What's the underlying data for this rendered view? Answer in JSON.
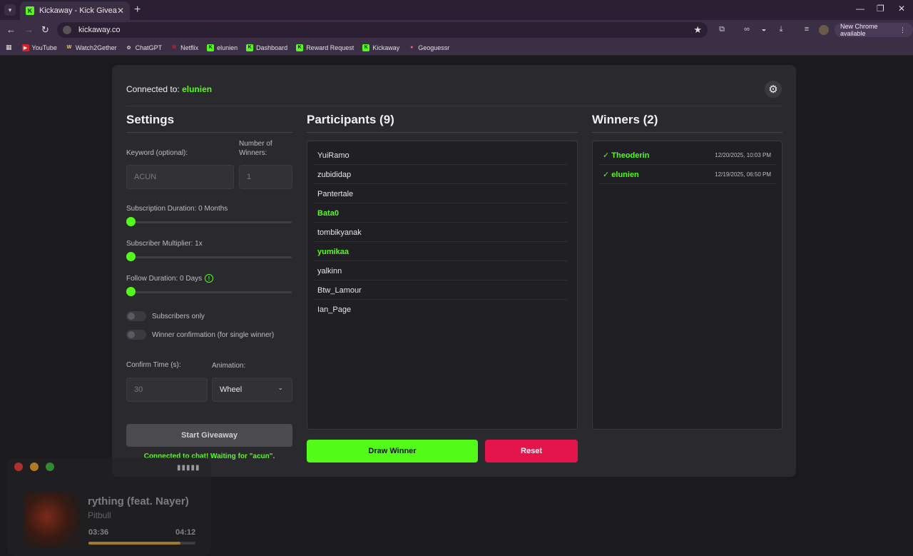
{
  "browser": {
    "tab_title": "Kickaway - Kick Giveaway Tool",
    "url": "kickaway.co",
    "new_chrome_label": "New Chrome available",
    "bookmarks": [
      "YouTube",
      "Watch2Gether",
      "ChatGPT",
      "Netflix",
      "elunien",
      "Dashboard",
      "Reward Request",
      "Kickaway",
      "Geoguessr"
    ]
  },
  "header": {
    "connected_prefix": "Connected to:",
    "connected_user": "elunien"
  },
  "settings": {
    "title": "Settings",
    "keyword_label": "Keyword (optional):",
    "keyword_placeholder": "ACUN",
    "winners_label": "Number of Winners:",
    "winners_placeholder": "1",
    "subscription_label": "Subscription Duration: 0 Months",
    "subscription_value": 0,
    "multiplier_label": "Subscriber Multiplier: 1x",
    "multiplier_value": 1,
    "follow_label": "Follow Duration: 0 Days",
    "follow_value": 0,
    "subscribers_only_label": "Subscribers only",
    "winner_confirmation_label": "Winner confirmation (for single winner)",
    "confirm_time_label": "Confirm Time (s):",
    "confirm_time_placeholder": "30",
    "animation_label": "Animation:",
    "animation_value": "Wheel",
    "start_button": "Start Giveaway",
    "status": "Connected to chat! Waiting for \"acun\"."
  },
  "participants": {
    "title": "Participants (9)",
    "items": [
      {
        "name": "YuiRamo",
        "highlight": false
      },
      {
        "name": "zubididap",
        "highlight": false
      },
      {
        "name": "Pantertale",
        "highlight": false
      },
      {
        "name": "Bata0",
        "highlight": true
      },
      {
        "name": "tombikyanak",
        "highlight": false
      },
      {
        "name": "yumikaa",
        "highlight": true
      },
      {
        "name": "yalkinn",
        "highlight": false
      },
      {
        "name": "Btw_Lamour",
        "highlight": false
      },
      {
        "name": "Ian_Page",
        "highlight": false
      }
    ]
  },
  "winners": {
    "title": "Winners (2)",
    "items": [
      {
        "name": "✓ Theoderin",
        "date": "12/20/2025, 10:03 PM"
      },
      {
        "name": "✓ elunien",
        "date": "12/19/2025, 06:50 PM"
      }
    ]
  },
  "actions": {
    "draw": "Draw Winner",
    "reset": "Reset"
  },
  "media": {
    "song": "rything (feat. Nayer)",
    "artist": "Pitbull",
    "elapsed": "03:36",
    "total": "04:12",
    "progress": 0.857
  },
  "colors": {
    "accent": "#53fc18",
    "danger": "#e4154b",
    "card": "#2a2a2e",
    "background": "#1b1b1e"
  }
}
